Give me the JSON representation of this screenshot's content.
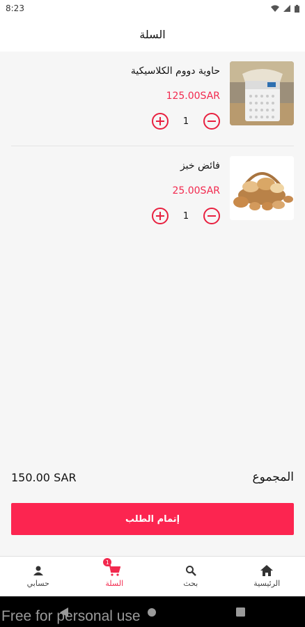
{
  "status_bar": {
    "time": "8:23"
  },
  "header": {
    "title": "السلة"
  },
  "cart": {
    "items": [
      {
        "name": "حاوية دووم الكلاسيكية",
        "price": "125.00SAR",
        "quantity": "1",
        "image_icon": "bread-bin-icon"
      },
      {
        "name": "فائض خبز",
        "price": "25.00SAR",
        "quantity": "1",
        "image_icon": "bread-basket-icon"
      }
    ],
    "total_label": "المجموع",
    "total_value": "150.00 SAR",
    "checkout_label": "إتمام الطلب"
  },
  "bottom_nav": {
    "items": [
      {
        "label": "حسابي",
        "icon": "person-icon",
        "active": false
      },
      {
        "label": "السلة",
        "icon": "cart-icon",
        "active": true,
        "badge": "1"
      },
      {
        "label": "بحث",
        "icon": "search-icon",
        "active": false
      },
      {
        "label": "الرئيسية",
        "icon": "home-icon",
        "active": false
      }
    ]
  },
  "watermark": "Free for personal use",
  "colors": {
    "accent": "#fc2550",
    "price": "#f2294e",
    "background": "#f6f6f6"
  }
}
